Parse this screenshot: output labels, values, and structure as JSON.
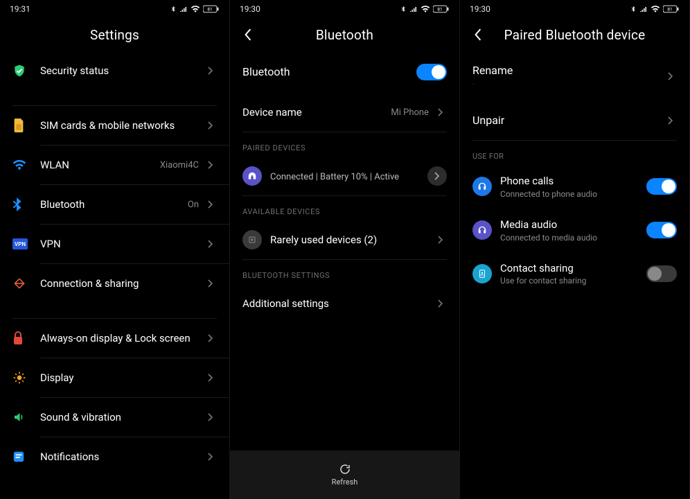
{
  "status": {
    "s1_time": "19:31",
    "s2_time": "19:30",
    "s3_time": "19:30",
    "battery": "81"
  },
  "screen1": {
    "title": "Settings",
    "items": {
      "security": "Security status",
      "sim": "SIM cards & mobile networks",
      "wlan": "WLAN",
      "wlan_value": "Xiaomi4C",
      "bluetooth": "Bluetooth",
      "bluetooth_value": "On",
      "vpn": "VPN",
      "connection": "Connection & sharing",
      "aod": "Always-on display & Lock screen",
      "display": "Display",
      "sound": "Sound & vibration",
      "notifications": "Notifications"
    }
  },
  "screen2": {
    "title": "Bluetooth",
    "bluetooth_label": "Bluetooth",
    "device_name_label": "Device name",
    "device_name_value": "Mi Phone",
    "section_paired": "PAIRED DEVICES",
    "paired_status": "Connected | Battery 10% | Active",
    "section_available": "AVAILABLE DEVICES",
    "rarely_used": "Rarely used devices (2)",
    "section_settings": "BLUETOOTH SETTINGS",
    "additional": "Additional settings",
    "refresh": "Refresh"
  },
  "screen3": {
    "title": "Paired Bluetooth device",
    "rename": "Rename",
    "unpair": "Unpair",
    "section_usefor": "USE FOR",
    "phone_calls": "Phone calls",
    "phone_calls_sub": "Connected to phone audio",
    "media_audio": "Media audio",
    "media_audio_sub": "Connected to media audio",
    "contact_sharing": "Contact sharing",
    "contact_sharing_sub": "Use for contact sharing"
  }
}
